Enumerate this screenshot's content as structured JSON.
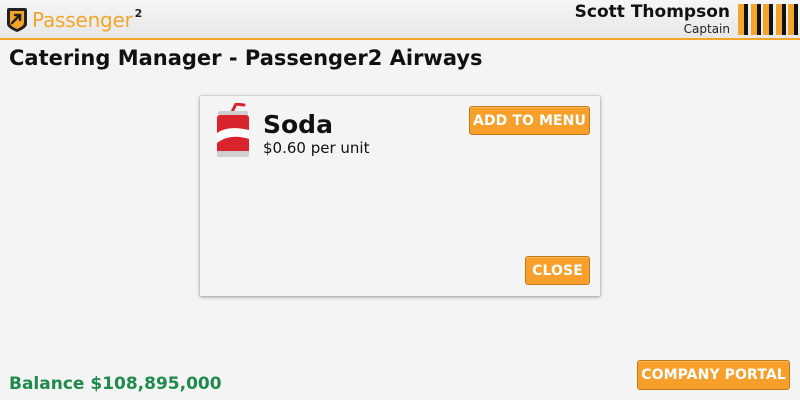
{
  "header": {
    "brand": "Passenger",
    "brand_superscript": "2",
    "user_name": "Scott Thompson",
    "user_role": "Captain",
    "logo_icon": "passenger-logo-icon",
    "rank_icon": "captain-stripes-icon",
    "accent_color": "#f3a52a"
  },
  "page": {
    "title": "Catering Manager - Passenger2 Airways"
  },
  "dialog": {
    "item_icon": "soda-can-icon",
    "item_name": "Soda",
    "item_price": "$0.60 per unit",
    "add_button_label": "ADD TO MENU",
    "close_button_label": "CLOSE"
  },
  "footer": {
    "balance_label": "Balance",
    "balance_value": "$108,895,000",
    "balance_color": "#1f8a4c",
    "portal_button_label": "COMPANY PORTAL"
  }
}
